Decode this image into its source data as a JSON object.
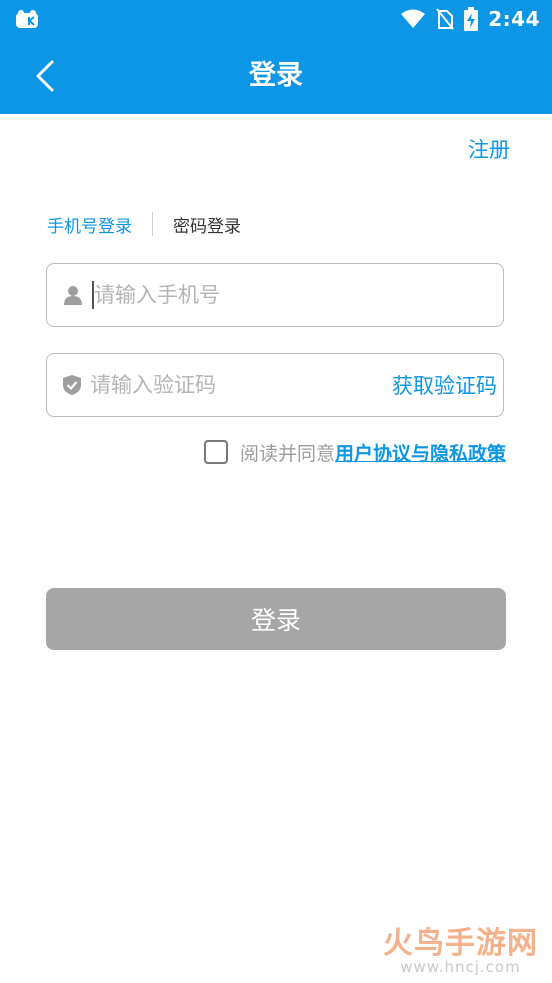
{
  "status_bar": {
    "time": "2:44"
  },
  "nav": {
    "title": "登录"
  },
  "register_label": "注册",
  "tabs": [
    {
      "label": "手机号登录",
      "active": true
    },
    {
      "label": "密码登录",
      "active": false
    }
  ],
  "phone_input": {
    "placeholder": "请输入手机号",
    "value": ""
  },
  "code_input": {
    "placeholder": "请输入验证码",
    "value": ""
  },
  "get_code_label": "获取验证码",
  "agreement": {
    "checked": false,
    "text": "阅读并同意",
    "link": "用户协议与隐私政策"
  },
  "login_button_label": "登录",
  "watermark": {
    "name": "火鸟手游网",
    "url": "www.hncj.com"
  },
  "colors": {
    "primary": "#0d96e6",
    "disabled_button": "#a6a6a6",
    "placeholder": "#b5b5b5"
  }
}
